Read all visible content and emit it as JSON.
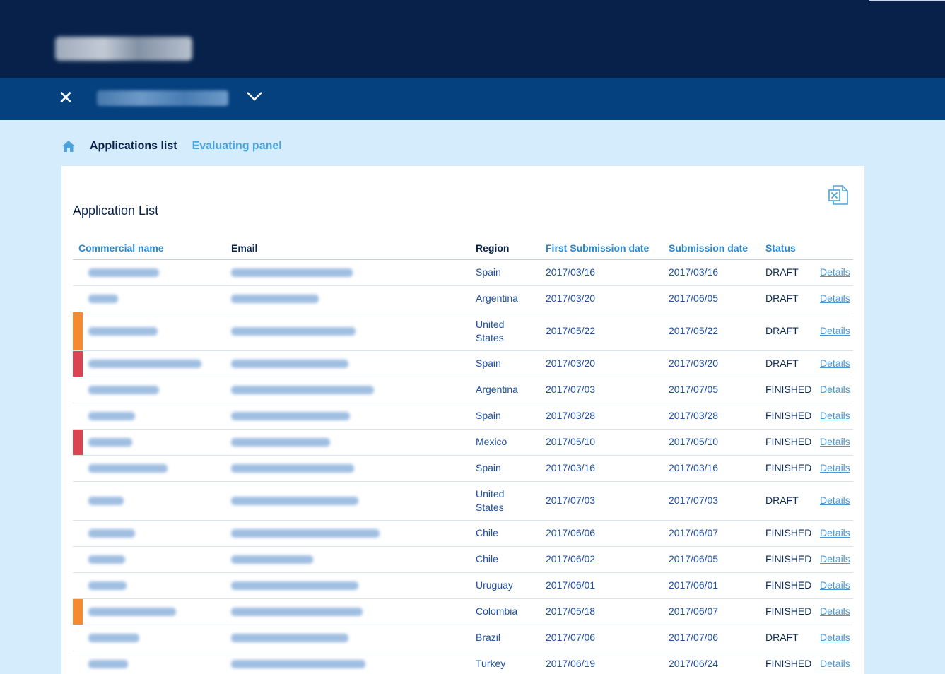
{
  "breadcrumb": {
    "active": "Applications list",
    "link": "Evaluating panel"
  },
  "panel": {
    "title": "Application List",
    "export_icon": "excel-export-icon"
  },
  "table": {
    "headers": [
      "Commercial name",
      "Email",
      "Region",
      "First Submission date",
      "Submission date",
      "Status"
    ],
    "details_label": "Details",
    "rows": [
      {
        "marker": "none",
        "region": "Spain",
        "first": "2017/03/16",
        "submitted": "2017/03/16",
        "status": "DRAFT"
      },
      {
        "marker": "none",
        "region": "Argentina",
        "first": "2017/03/20",
        "submitted": "2017/06/05",
        "status": "DRAFT"
      },
      {
        "marker": "orange",
        "region": "United States",
        "first": "2017/05/22",
        "submitted": "2017/05/22",
        "status": "DRAFT"
      },
      {
        "marker": "red",
        "region": "Spain",
        "first": "2017/03/20",
        "submitted": "2017/03/20",
        "status": "DRAFT"
      },
      {
        "marker": "none",
        "region": "Argentina",
        "first": "2017/07/03",
        "submitted": "2017/07/05",
        "status": "FINISHED"
      },
      {
        "marker": "none",
        "region": "Spain",
        "first": "2017/03/28",
        "submitted": "2017/03/28",
        "status": "FINISHED"
      },
      {
        "marker": "red",
        "region": "Mexico",
        "first": "2017/05/10",
        "submitted": "2017/05/10",
        "status": "FINISHED"
      },
      {
        "marker": "none",
        "region": "Spain",
        "first": "2017/03/16",
        "submitted": "2017/03/16",
        "status": "FINISHED"
      },
      {
        "marker": "none",
        "region": "United States",
        "first": "2017/07/03",
        "submitted": "2017/07/03",
        "status": "DRAFT"
      },
      {
        "marker": "none",
        "region": "Chile",
        "first": "2017/06/06",
        "submitted": "2017/06/07",
        "status": "FINISHED"
      },
      {
        "marker": "none",
        "region": "Chile",
        "first": "2017/06/02",
        "submitted": "2017/06/05",
        "status": "FINISHED"
      },
      {
        "marker": "none",
        "region": "Uruguay",
        "first": "2017/06/01",
        "submitted": "2017/06/01",
        "status": "FINISHED"
      },
      {
        "marker": "orange",
        "region": "Colombia",
        "first": "2017/05/18",
        "submitted": "2017/06/07",
        "status": "FINISHED"
      },
      {
        "marker": "none",
        "region": "Brazil",
        "first": "2017/07/06",
        "submitted": "2017/07/06",
        "status": "DRAFT"
      },
      {
        "marker": "none",
        "region": "Turkey",
        "first": "2017/06/19",
        "submitted": "2017/06/24",
        "status": "FINISHED"
      }
    ]
  },
  "colors": {
    "top_bar": "#07214a",
    "sub_bar": "#05407f",
    "background": "#d4ecfb",
    "marker_orange": "#f58a2e",
    "marker_red": "#db4453",
    "link": "#4a97d6"
  }
}
